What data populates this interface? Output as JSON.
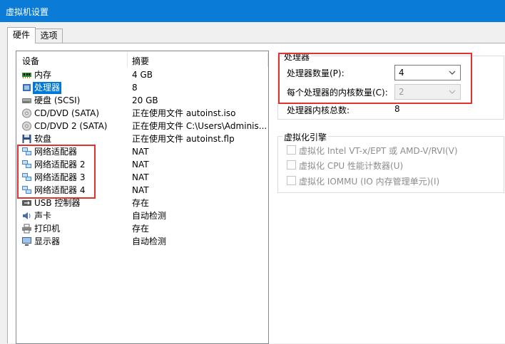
{
  "window": {
    "title": "虚拟机设置"
  },
  "tabs": [
    {
      "label": "硬件",
      "active": true
    },
    {
      "label": "选项",
      "active": false
    }
  ],
  "device_list": {
    "columns": [
      "设备",
      "摘要"
    ],
    "rows": [
      {
        "name": "内存",
        "summary": "4 GB",
        "icon": "memory-icon"
      },
      {
        "name": "处理器",
        "summary": "8",
        "icon": "processor-icon",
        "selected": true
      },
      {
        "name": "硬盘 (SCSI)",
        "summary": "20 GB",
        "icon": "hard-disk-icon"
      },
      {
        "name": "CD/DVD (SATA)",
        "summary": "正在使用文件 autoinst.iso",
        "icon": "cd-dvd-icon"
      },
      {
        "name": "CD/DVD 2 (SATA)",
        "summary": "正在使用文件 C:\\Users\\Adminis...",
        "icon": "cd-dvd-icon"
      },
      {
        "name": "软盘",
        "summary": "正在使用文件 autoinst.flp",
        "icon": "floppy-icon"
      },
      {
        "name": "网络适配器",
        "summary": "NAT",
        "icon": "network-adapter-icon"
      },
      {
        "name": "网络适配器 2",
        "summary": "NAT",
        "icon": "network-adapter-icon"
      },
      {
        "name": "网络适配器 3",
        "summary": "NAT",
        "icon": "network-adapter-icon"
      },
      {
        "name": "网络适配器 4",
        "summary": "NAT",
        "icon": "network-adapter-icon"
      },
      {
        "name": "USB 控制器",
        "summary": "存在",
        "icon": "usb-icon"
      },
      {
        "name": "声卡",
        "summary": "自动检测",
        "icon": "sound-card-icon"
      },
      {
        "name": "打印机",
        "summary": "存在",
        "icon": "printer-icon"
      },
      {
        "name": "显示器",
        "summary": "自动检测",
        "icon": "display-icon"
      }
    ]
  },
  "processor": {
    "group_title": "处理器",
    "count_label": "处理器数量(P):",
    "count_value": "4",
    "cores_label": "每个处理器的内核数量(C):",
    "cores_value": "2",
    "total_label": "处理器内核总数:",
    "total_value": "8"
  },
  "virtualization": {
    "group_title": "虚拟化引擎",
    "options": [
      {
        "label": "虚拟化 Intel VT-x/EPT 或 AMD-V/RVI(V)",
        "checked": false,
        "enabled": false
      },
      {
        "label": "虚拟化 CPU 性能计数器(U)",
        "checked": false,
        "enabled": false
      },
      {
        "label": "虚拟化 IOMMU (IO 内存管理单元)(I)",
        "checked": false,
        "enabled": false
      }
    ]
  },
  "colors": {
    "titlebar": "#0a7bd6",
    "selection": "#0078d7",
    "highlight_box": "#e0332f"
  }
}
